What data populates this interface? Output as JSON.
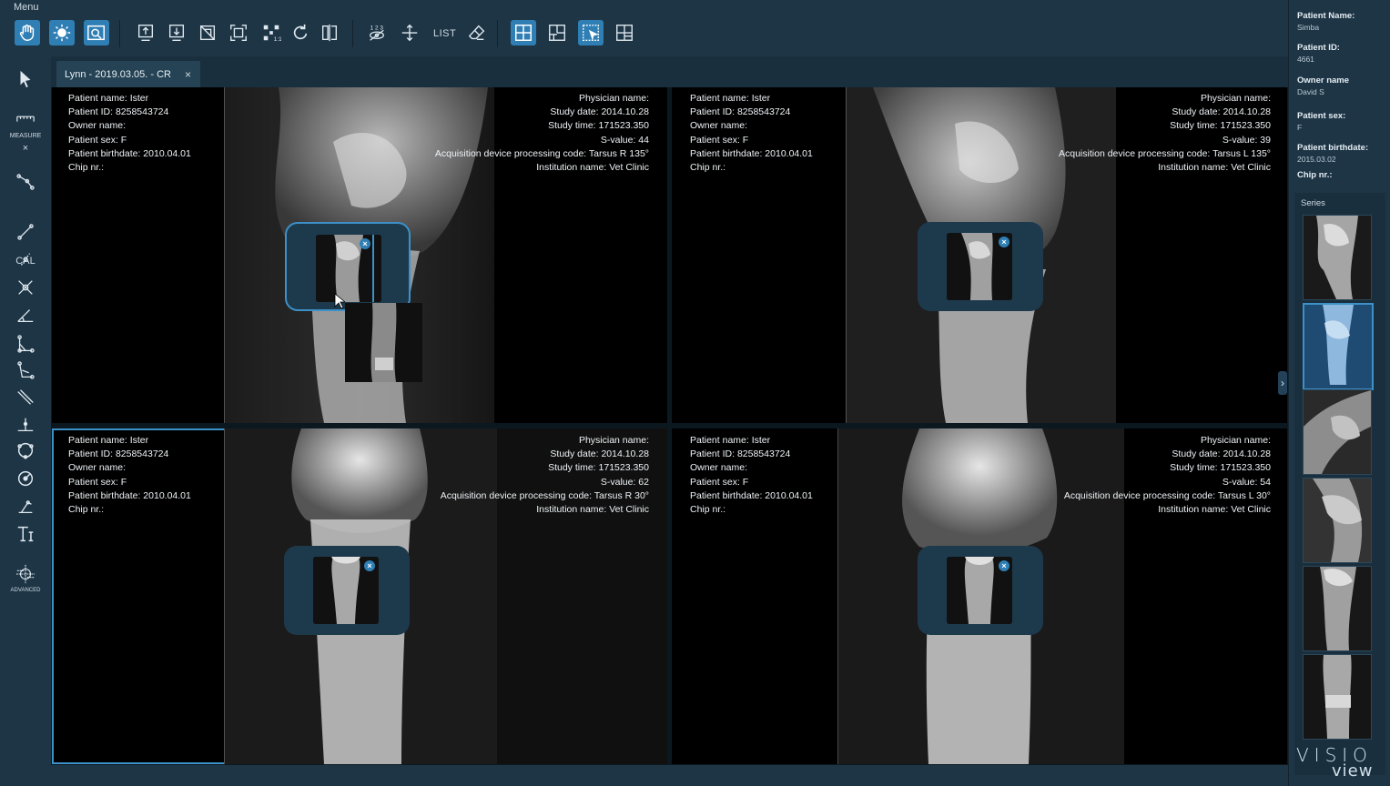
{
  "app": {
    "menu_label": "Menu",
    "brand_top": "VISIO",
    "brand_bottom": "view",
    "accent": "#2f7fb5"
  },
  "toolbar": {
    "list_label": "LIST",
    "icons": [
      "pan-hand-icon",
      "brightness-icon",
      "zoom-region-icon",
      "export-up-icon",
      "export-down-icon",
      "crop-icon",
      "fit-screen-icon",
      "zoom-1to1-icon",
      "rotate-icon",
      "flip-icon",
      "hide-numbers-icon",
      "move-arrows-icon",
      "eraser-icon",
      "layout-2x2-icon",
      "layout-1-3-icon",
      "select-layout-icon",
      "layout-3-icon"
    ]
  },
  "left_tools": {
    "measure_label": "MEASURE",
    "cal_label": "CAL",
    "advanced_label": "ADVANCED"
  },
  "tab": {
    "title": "Lynn -  2019.03.05. - CR",
    "close": "×"
  },
  "viewports": [
    {
      "left": [
        "Patient name: Ister",
        "Patient ID: 8258543724",
        "Owner name:",
        "Patient sex: F",
        "Patient birthdate: 2010.04.01",
        "Chip nr.:"
      ],
      "right": [
        "Physician name:",
        "Study date: 2014.10.28",
        "Study time: 171523.350",
        "S-value: 44",
        "Acquisition device processing code: Tarsus R 135°",
        "Institution name: Vet Clinic"
      ]
    },
    {
      "left": [
        "Patient name: Ister",
        "Patient ID: 8258543724",
        "Owner name:",
        "Patient sex: F",
        "Patient birthdate: 2010.04.01",
        "Chip nr.:"
      ],
      "right": [
        "Physician name:",
        "Study date: 2014.10.28",
        "Study time: 171523.350",
        "S-value: 39",
        "Acquisition device processing code: Tarsus L 135°",
        "Institution name: Vet Clinic"
      ]
    },
    {
      "left": [
        "Patient name: Ister",
        "Patient ID: 8258543724",
        "Owner name:",
        "Patient sex: F",
        "Patient birthdate: 2010.04.01",
        "Chip nr.:"
      ],
      "right": [
        "Physician name:",
        "Study date: 2014.10.28",
        "Study time: 171523.350",
        "S-value: 62",
        "Acquisition device processing code: Tarsus R 30°",
        "Institution name: Vet Clinic"
      ]
    },
    {
      "left": [
        "Patient name: Ister",
        "Patient ID: 8258543724",
        "Owner name:",
        "Patient sex: F",
        "Patient birthdate: 2010.04.01",
        "Chip nr.:"
      ],
      "right": [
        "Physician name:",
        "Study date: 2014.10.28",
        "Study time: 171523.350",
        "S-value: 54",
        "Acquisition device processing code: Tarsus L 30°",
        "Institution name: Vet Clinic"
      ]
    }
  ],
  "patient_panel": {
    "name_label": "Patient Name:",
    "name": "Simba",
    "id_label": "Patient ID:",
    "id": "4661",
    "owner_label": "Owner name",
    "owner": "David S",
    "sex_label": "Patient sex:",
    "sex": "F",
    "birthdate_label": "Patient birthdate:",
    "birthdate": "2015.03.02",
    "chip_label": "Chip nr.:",
    "chip": ""
  },
  "series": {
    "label": "Series",
    "count": 6,
    "selected_index": 1
  }
}
